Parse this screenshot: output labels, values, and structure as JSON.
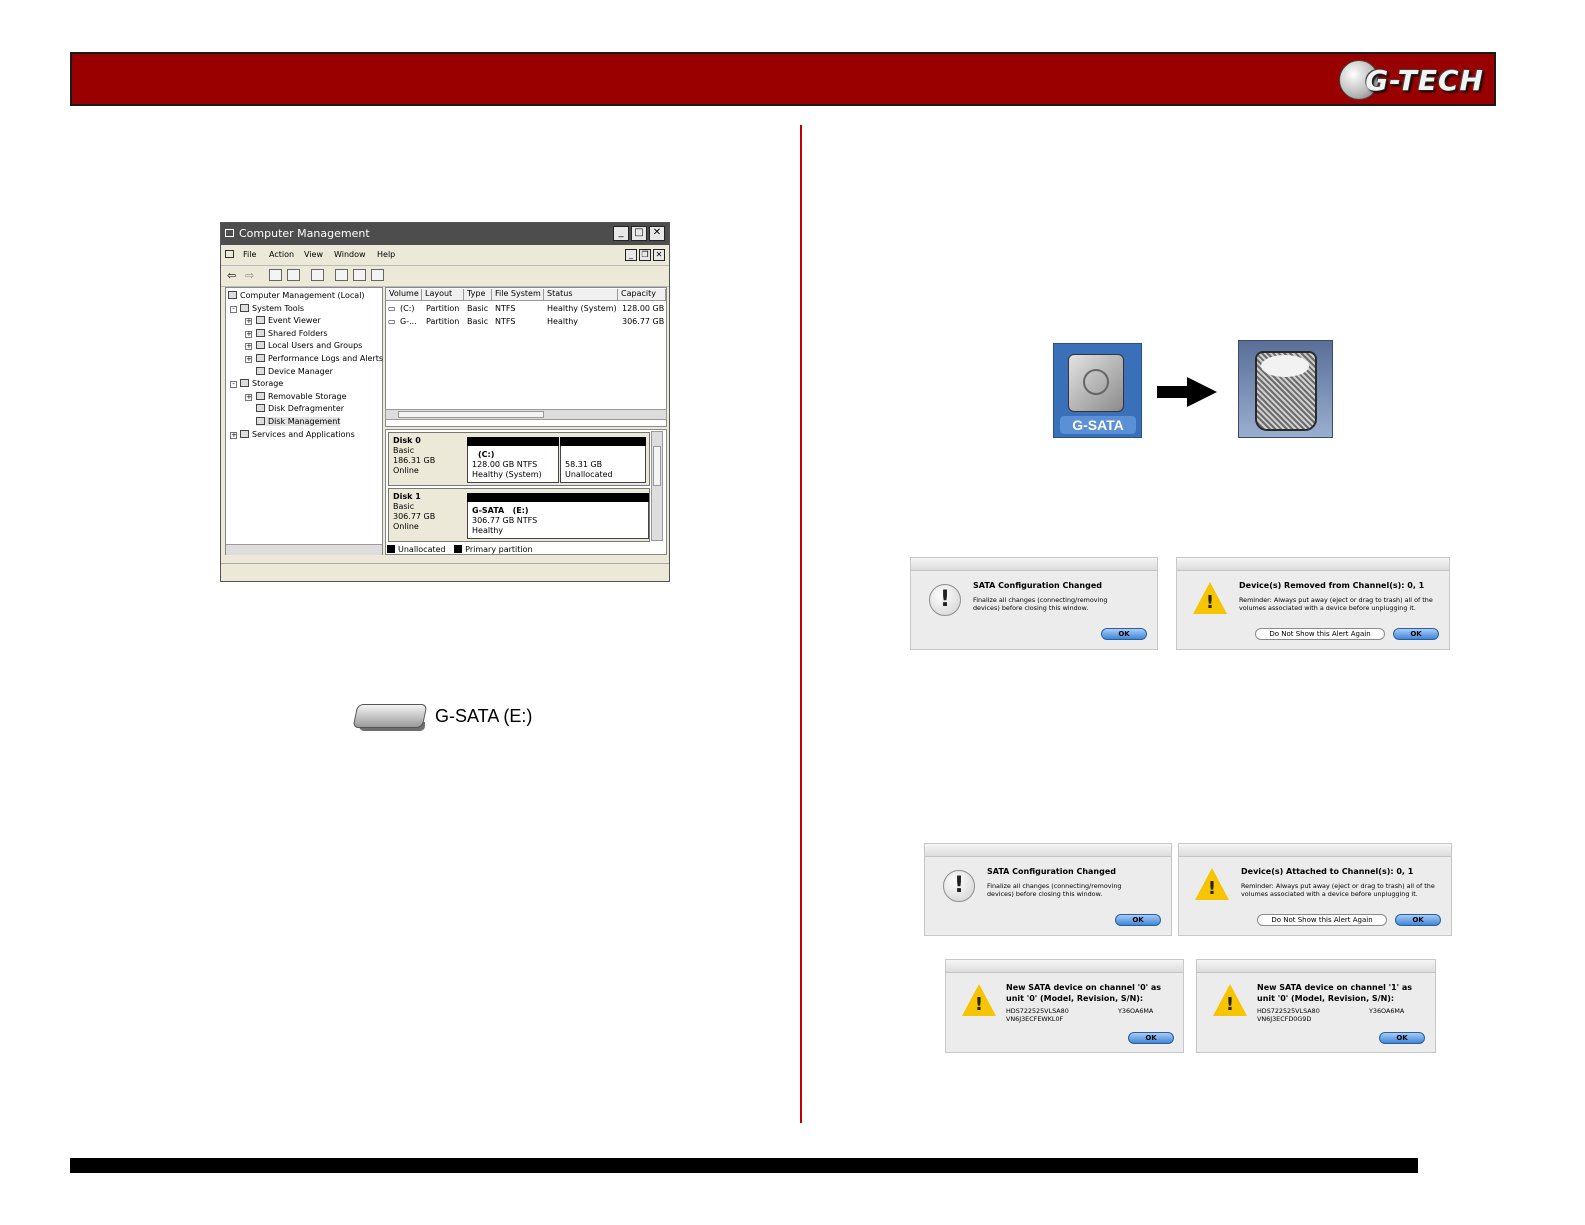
{
  "header": {
    "brand": "G-TECH"
  },
  "computer_management": {
    "title": "Computer Management",
    "menu": [
      "File",
      "Action",
      "View",
      "Window",
      "Help"
    ],
    "tree": {
      "root": "Computer Management (Local)",
      "system_tools": "System Tools",
      "event_viewer": "Event Viewer",
      "shared_folders": "Shared Folders",
      "local_users": "Local Users and Groups",
      "perf_logs": "Performance Logs and Alerts",
      "device_manager": "Device Manager",
      "storage": "Storage",
      "removable_storage": "Removable Storage",
      "disk_defrag": "Disk Defragmenter",
      "disk_management": "Disk Management",
      "services": "Services and Applications"
    },
    "columns": [
      "Volume",
      "Layout",
      "Type",
      "File System",
      "Status",
      "Capacity"
    ],
    "rows": [
      [
        "(C:)",
        "Partition",
        "Basic",
        "NTFS",
        "Healthy (System)",
        "128.00 GB"
      ],
      [
        "G-...",
        "Partition",
        "Basic",
        "NTFS",
        "Healthy",
        "306.77 GB"
      ]
    ],
    "disk0": {
      "name": "Disk 0",
      "type": "Basic",
      "size": "186.31 GB",
      "status": "Online",
      "part1": {
        "label": "(C:)",
        "size": "128.00 GB NTFS",
        "status": "Healthy (System)"
      },
      "part2": {
        "size": "58.31 GB",
        "status": "Unallocated"
      }
    },
    "disk1": {
      "name": "Disk 1",
      "type": "Basic",
      "size": "306.77 GB",
      "status": "Online",
      "part1": {
        "label": "G-SATA   (E:)",
        "size": "306.77 GB NTFS",
        "status": "Healthy"
      }
    },
    "legend": {
      "unallocated": "Unallocated",
      "primary": "Primary partition"
    }
  },
  "drive_icon": {
    "label": "G-SATA (E:)"
  },
  "mac_drive": {
    "label": "G-SATA"
  },
  "dialogs": {
    "d1": {
      "title": "SATA Configuration Changed",
      "message": "Finalize all changes (connecting/removing devices) before closing this window.",
      "ok": "OK"
    },
    "d2": {
      "title": "Device(s) Removed from Channel(s): 0, 1",
      "message": "Reminder: Always put away (eject or drag to trash) all of the volumes associated with a device before unplugging it.",
      "secondary": "Do Not Show this Alert Again",
      "ok": "OK"
    },
    "d3": {
      "title": "SATA Configuration Changed",
      "message": "Finalize all changes (connecting/removing devices) before closing this window.",
      "ok": "OK"
    },
    "d4": {
      "title": "Device(s) Attached to Channel(s): 0, 1",
      "message": "Reminder: Always put away (eject or drag to trash) all of the volumes associated with a device before unplugging it.",
      "secondary": "Do Not Show this Alert Again",
      "ok": "OK"
    },
    "d5": {
      "title": "New SATA device on channel '0' as unit '0' (Model, Revision, S/N):",
      "model": "HDS722525VLSA80",
      "revision": "Y36OA6MA",
      "serial": "VN6J3ECFEWKL0F",
      "ok": "OK"
    },
    "d6": {
      "title": "New SATA device on channel '1' as unit '0' (Model, Revision, S/N):",
      "model": "HDS722525VLSA80",
      "revision": "Y36OA6MA",
      "serial": "VN6J3ECFD0G9D",
      "ok": "OK"
    }
  }
}
